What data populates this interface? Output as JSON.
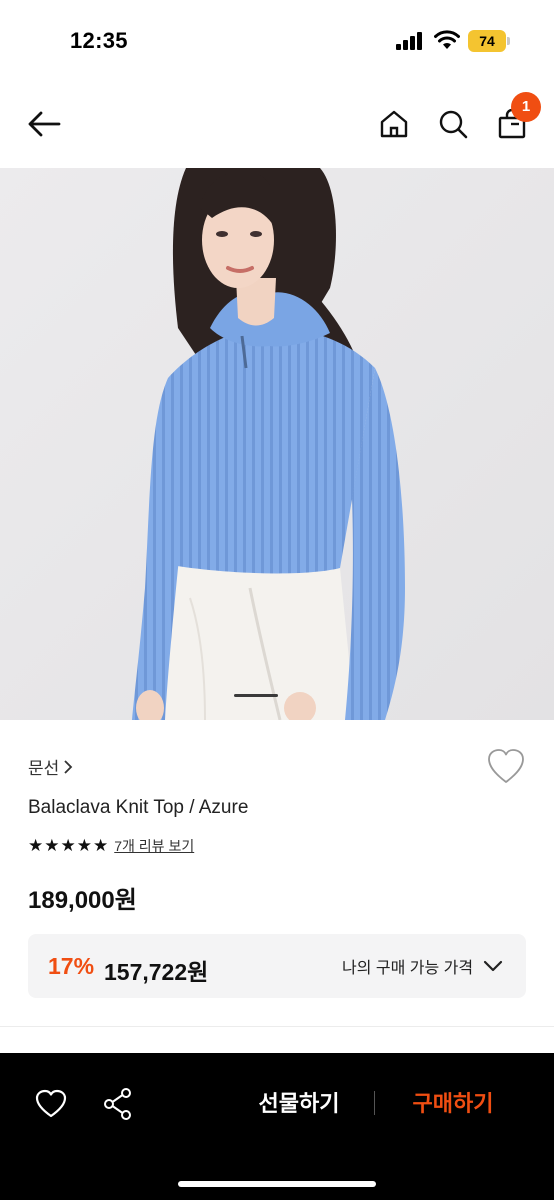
{
  "status_bar": {
    "time": "12:35",
    "battery_level": "74",
    "battery_color": "#f4c430"
  },
  "header": {
    "icons": [
      "back-arrow-icon",
      "home-icon",
      "search-icon",
      "shopping-bag-icon"
    ],
    "cart_count": "1",
    "badge_color": "#f04e12"
  },
  "product_image": {
    "carousel_position": 1
  },
  "product": {
    "brand": "문선",
    "name": "Balaclava Knit Top / Azure",
    "rating_stars": 5,
    "review_link": "7개 리뷰 보기",
    "original_price": "189,000원",
    "discount_rate": "17%",
    "discount_price": "157,722원",
    "purchase_price_label": "나의 구매 가능 가격"
  },
  "bottom_bar": {
    "gift_label": "선물하기",
    "buy_label": "구매하기",
    "accent_color": "#f04e12"
  }
}
